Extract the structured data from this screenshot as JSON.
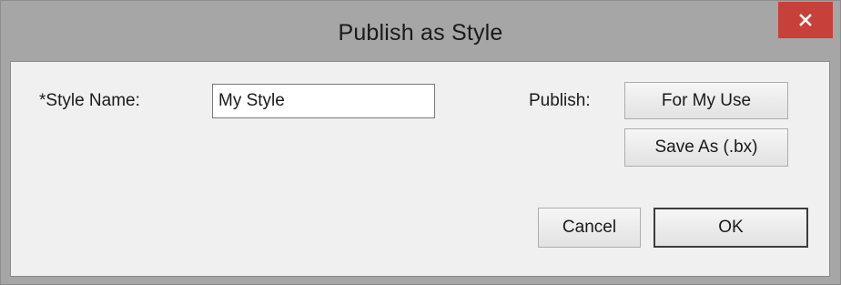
{
  "window": {
    "title": "Publish as Style"
  },
  "form": {
    "style_name_label": "*Style Name:",
    "style_name_value": "My Style",
    "publish_label": "Publish:"
  },
  "buttons": {
    "for_my_use": "For My Use",
    "save_as": "Save As (.bx)",
    "cancel": "Cancel",
    "ok": "OK"
  },
  "icons": {
    "close": "close-icon"
  },
  "colors": {
    "close_button": "#c7403a",
    "frame": "#a6a6a6",
    "client_background": "#f0f0f0"
  }
}
